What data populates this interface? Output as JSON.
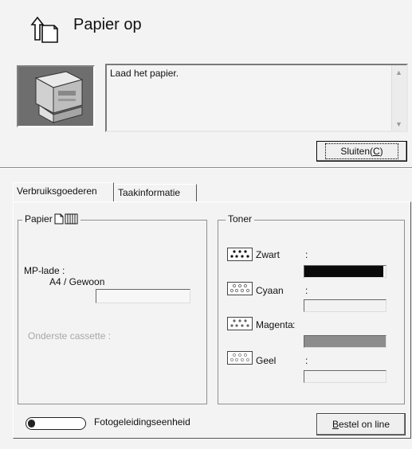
{
  "header": {
    "title": "Papier op",
    "icon": "paper-out-icon"
  },
  "message": {
    "text": "Laad het papier.",
    "image": "printer-image"
  },
  "close_button": {
    "label_main": "Sluiten(",
    "label_key": "C",
    "label_end": ")"
  },
  "tabs": [
    {
      "label": "Verbruiksgoederen",
      "active": true
    },
    {
      "label": "Taakinformatie",
      "active": false
    }
  ],
  "paper": {
    "legend": "Papier",
    "mp_label": "MP-lade :",
    "mp_value": "A4 / Gewoon",
    "mp_level": 0,
    "lower_cassette": "Onderste cassette :"
  },
  "toner": {
    "legend": "Toner",
    "items": [
      {
        "name": "Zwart",
        "colon": ":",
        "level": 0.97,
        "color": "#0a0a0a"
      },
      {
        "name": "Cyaan",
        "colon": ":",
        "level": 0.0,
        "color": "#9a9a9a"
      },
      {
        "name": "Magenta",
        "colon": ":",
        "level": 1.0,
        "color": "#8c8c8c"
      },
      {
        "name": "Geel",
        "colon": ":",
        "level": 0.0,
        "color": "#d8d8d8"
      }
    ]
  },
  "photoconductor": {
    "label": "Fotogeleidingseenheid",
    "level": 0.12
  },
  "order_button": {
    "label_key": "B",
    "label_rest": "estel on line"
  }
}
